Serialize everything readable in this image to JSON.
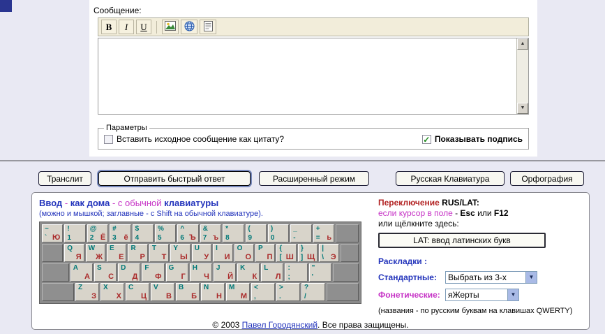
{
  "colors": {
    "navy": "#2A3590",
    "blue": "#2233BB",
    "magenta": "#C633C6",
    "red": "#B22222",
    "teal": "#007878",
    "keyred": "#AA2A2A",
    "green": "#1E8A1E"
  },
  "form": {
    "label": "Сообщение:",
    "toolbar": {
      "bold_label": "B",
      "italic_label": "I",
      "underline_label": "U",
      "icons": [
        "image-icon",
        "globe-link-icon",
        "quote-icon"
      ]
    },
    "textarea_value": "",
    "params": {
      "legend": "Параметры",
      "quote_label": "Вставить исходное сообщение как цитату?",
      "quote_checked": false,
      "signature_label": "Показывать подпись",
      "signature_checked": true
    }
  },
  "buttons": {
    "translit": "Транслит",
    "send": "Отправить быстрый ответ",
    "extended": "Расширенный режим",
    "rus_kbd": "Русская Клавиатура",
    "spelling": "Орфография"
  },
  "panel": {
    "intro_line1": [
      {
        "t": "Ввод",
        "c": "blue-bold"
      },
      {
        "t": " - ",
        "c": "magenta"
      },
      {
        "t": "как дома",
        "c": "blue-bold"
      },
      {
        "t": " - ",
        "c": "magenta"
      },
      {
        "t": "с обычной ",
        "c": "magenta"
      },
      {
        "t": "клавиатуры",
        "c": "blue-bold"
      }
    ],
    "intro_line2": "(можно и мышкой; заглавные - с Shift на обычной клавиатуре).",
    "switch_line1": [
      {
        "t": "Переключение ",
        "c": "red-bold"
      },
      {
        "t": "RUS/LAT:",
        "c": "black-bold"
      }
    ],
    "switch_line2": [
      {
        "t": "если курсор в поле",
        "c": "magenta"
      },
      {
        "t": " - ",
        "c": "black"
      },
      {
        "t": "Esc",
        "c": "black-bold"
      },
      {
        "t": " или ",
        "c": "black"
      },
      {
        "t": "F12",
        "c": "black-bold"
      }
    ],
    "switch_line3": "или щёлкните здесь:",
    "lat_button": "LAT: ввод латинских букв",
    "layouts_label": "Раскладки :",
    "standard_label": "Стандартные:",
    "standard_value": "Выбрать из 3-х",
    "phonetic_label": "Фонетические:",
    "phonetic_value": "яЖерты",
    "note": "(названия - по русским буквам на клавишах QWERTY)",
    "footer": [
      {
        "t": "© 2003 ",
        "c": "black"
      },
      {
        "t": "Павел Городянский",
        "c": "link"
      },
      {
        "t": ". Все права защищены.",
        "c": "black"
      }
    ]
  },
  "keyboard": {
    "rows": [
      {
        "keys": [
          {
            "tl": "~",
            "bl": "`",
            "br": "Ю"
          },
          {
            "tl": "!",
            "bl": "1"
          },
          {
            "tl": "@",
            "bl": "2",
            "br": "Ё"
          },
          {
            "tl": "#",
            "bl": "3",
            "br": "ё"
          },
          {
            "tl": "$",
            "bl": "4"
          },
          {
            "tl": "%",
            "bl": "5"
          },
          {
            "tl": "^",
            "bl": "6",
            "br": "Ъ"
          },
          {
            "tl": "&",
            "bl": "7",
            "br": "ъ"
          },
          {
            "tl": "*",
            "bl": "8"
          },
          {
            "tl": "(",
            "bl": "9"
          },
          {
            "tl": ")",
            "bl": "0"
          },
          {
            "tl": "_",
            "bl": "-"
          },
          {
            "tl": "+",
            "bl": "=",
            "br": "ь"
          },
          {
            "gray": true,
            "grow": 1.4
          }
        ]
      },
      {
        "keys": [
          {
            "gray": true,
            "grow": 1.4
          },
          {
            "tl": "Q",
            "br": "Я"
          },
          {
            "tl": "W",
            "br": "Ж"
          },
          {
            "tl": "E",
            "br": "Е"
          },
          {
            "tl": "R",
            "br": "Р"
          },
          {
            "tl": "T",
            "br": "Т"
          },
          {
            "tl": "Y",
            "br": "Ы"
          },
          {
            "tl": "U",
            "br": "У"
          },
          {
            "tl": "I",
            "br": "И"
          },
          {
            "tl": "O",
            "br": "О"
          },
          {
            "tl": "P",
            "br": "П"
          },
          {
            "tl": "{",
            "bl": "[",
            "br": "Ш"
          },
          {
            "tl": "}",
            "bl": "]",
            "br": "Щ"
          },
          {
            "tl": "|",
            "bl": "\\",
            "br": "Э"
          },
          {
            "gray": true,
            "grow": 0.5
          }
        ]
      },
      {
        "keys": [
          {
            "gray": true,
            "grow": 1.8
          },
          {
            "tl": "A",
            "br": "А"
          },
          {
            "tl": "S",
            "br": "С"
          },
          {
            "tl": "D",
            "br": "Д"
          },
          {
            "tl": "F",
            "br": "Ф"
          },
          {
            "tl": "G",
            "br": "Г"
          },
          {
            "tl": "H",
            "br": "Ч"
          },
          {
            "tl": "J",
            "br": "Й"
          },
          {
            "tl": "K",
            "br": "К"
          },
          {
            "tl": "L",
            "br": "Л"
          },
          {
            "tl": ":",
            "bl": ";"
          },
          {
            "tl": "\"",
            "bl": "'"
          },
          {
            "gray": true,
            "grow": 1.6
          }
        ]
      },
      {
        "keys": [
          {
            "gray": true,
            "grow": 2.2
          },
          {
            "tl": "Z",
            "br": "З"
          },
          {
            "tl": "X",
            "br": "Х"
          },
          {
            "tl": "C",
            "br": "Ц"
          },
          {
            "tl": "V",
            "br": "В"
          },
          {
            "tl": "B",
            "br": "Б"
          },
          {
            "tl": "N",
            "br": "Н"
          },
          {
            "tl": "M",
            "br": "М"
          },
          {
            "tl": "<",
            "bl": ","
          },
          {
            "tl": ">",
            "bl": "."
          },
          {
            "tl": "?",
            "bl": "/"
          },
          {
            "gray": true,
            "grow": 2.2
          }
        ]
      }
    ]
  }
}
